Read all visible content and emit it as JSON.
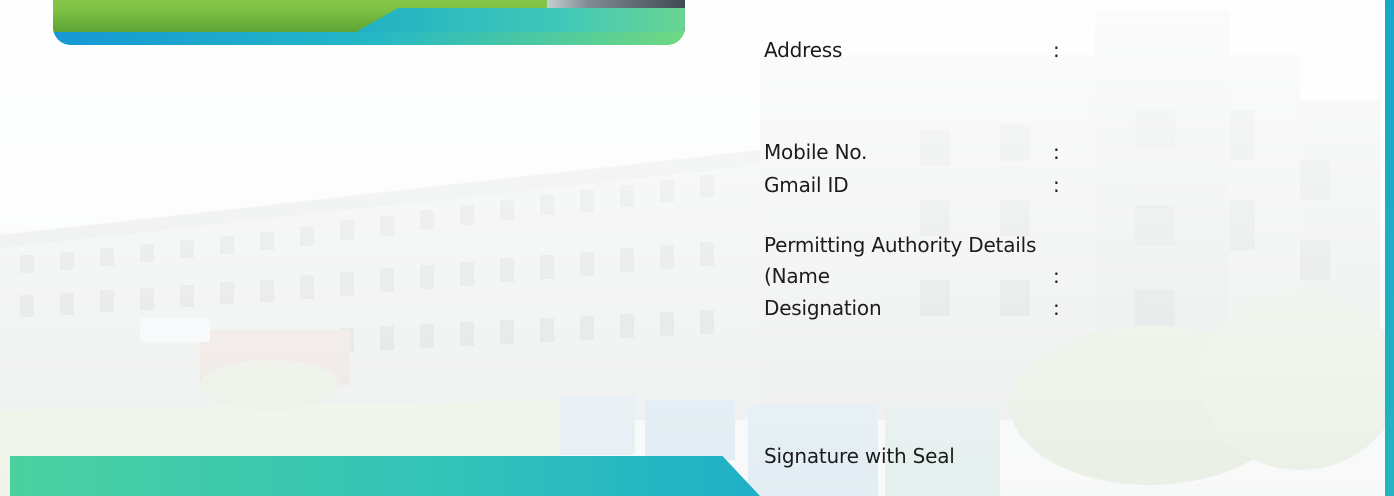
{
  "form": {
    "address_label": "Address",
    "mobile_label": "Mobile No.",
    "gmail_label": "Gmail ID",
    "authority_heading": "Permitting Authority Details",
    "name_label": "(Name",
    "designation_label": "Designation",
    "signature_label": "Signature with Seal",
    "separator": ":"
  },
  "colors": {
    "accent_teal": "#23b5c0",
    "accent_green": "#6fd882",
    "accent_blue": "#1698d4",
    "text": "#1c1c1c"
  }
}
